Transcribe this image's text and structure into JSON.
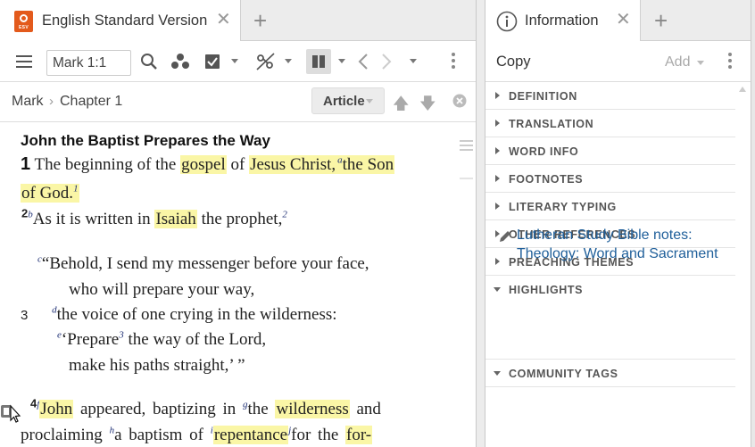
{
  "left_tab": {
    "title": "English Standard Version",
    "icon": "esv-book-icon",
    "icon_label": "ESV",
    "color": "#e35a1c"
  },
  "right_tab": {
    "title": "Information",
    "icon": "info-circle-icon"
  },
  "toolbar": {
    "reference": "Mark 1:1",
    "icons": [
      "menu-icon",
      "search-icon",
      "visual-filter-icon",
      "checklist-icon",
      "interlinear-icon",
      "columns-icon",
      "back-icon",
      "forward-icon"
    ]
  },
  "breadcrumb": {
    "book": "Mark",
    "separator": "›",
    "chapter": "Chapter 1"
  },
  "article_button": "Article",
  "passage": {
    "heading": "John the Baptist Prepares the Way",
    "lines": {
      "l1_chap": "1",
      "l1_a": "The beginning of the ",
      "l1_gospel": "gospel",
      "l1_b": " of ",
      "l1_jesus": "Jesus Christ,",
      "l1_sup": "a",
      "l1_son": "the Son",
      "l2_god": "of God.",
      "l2_fn": "1",
      "l3_v": "2",
      "l3_sup": "b",
      "l3_a": "As it is written in ",
      "l3_isaiah": "Isaiah",
      "l3_b": " the prophet,",
      "l3_fn": "2",
      "l4_sup": "c",
      "l4_text": "“Behold, I send my messenger before your face,",
      "l5_text": "who will prepare your way,",
      "l6_v": "3",
      "l6_sup": "d",
      "l6_text": "the voice of one crying in the wilderness:",
      "l7_sup": "e",
      "l7_a": "‘Prepare",
      "l7_fn": "3",
      "l7_b": " the way of the Lord,",
      "l8_text": "make his paths straight,’ ”",
      "l9_v": "4",
      "l9_sup": "f",
      "l9_john": "John",
      "l9_a": " appeared, baptizing in ",
      "l9_sup2": "g",
      "l9_b": "the ",
      "l9_wild": "wilderness",
      "l9_c": " and",
      "l10_a": "proclaiming ",
      "l10_sup": "h",
      "l10_b": "a baptism of ",
      "l10_sup2": "i",
      "l10_rep": "repentance",
      "l10_sup3": "j",
      "l10_c": "for the ",
      "l10_for": "for-"
    },
    "highlight_color": "#faf6a6"
  },
  "info": {
    "copy": "Copy",
    "add": "Add",
    "sections": [
      {
        "label": "DEFINITION",
        "open": false
      },
      {
        "label": "TRANSLATION",
        "open": false
      },
      {
        "label": "WORD INFO",
        "open": false
      },
      {
        "label": "FOOTNOTES",
        "open": false
      },
      {
        "label": "LITERARY TYPING",
        "open": false
      },
      {
        "label": "OTHER REFERENCES",
        "open": false
      },
      {
        "label": "PREACHING THEMES",
        "open": false
      },
      {
        "label": "HIGHLIGHTS",
        "open": true
      },
      {
        "label": "COMMUNITY TAGS",
        "open": true
      }
    ],
    "highlight_entry": "Lutheran Study Bible notes: Theology: Word and Sacrament",
    "link_color": "#1f5f9a"
  }
}
